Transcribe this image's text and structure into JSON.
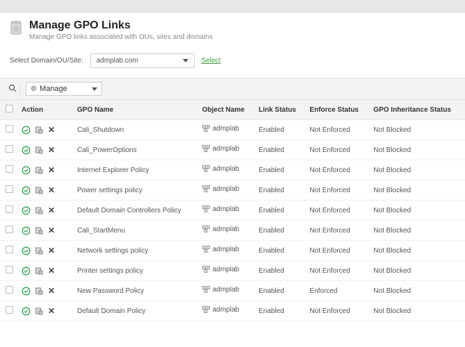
{
  "header": {
    "title": "Manage GPO Links",
    "subtitle": "Manage GPO links associated with OUs, sites and domains"
  },
  "filter": {
    "label": "Select Domain/OU/Site:",
    "domain_value": "admplab.com",
    "select_label": "Select"
  },
  "toolbar": {
    "manage_label": "Manage"
  },
  "columns": {
    "action": "Action",
    "gpo_name": "GPO Name",
    "object_name": "Object Name",
    "link_status": "Link Status",
    "enforce_status": "Enforce Status",
    "inheritance": "GPO Inheritance Status"
  },
  "rows": [
    {
      "gpo": "Cali_Shutdown",
      "obj": "admplab",
      "link": "Enabled",
      "enforce": "Not Enforced",
      "inherit": "Not Blocked"
    },
    {
      "gpo": "Cali_PowerOptions",
      "obj": "admplab",
      "link": "Enabled",
      "enforce": "Not Enforced",
      "inherit": "Not Blocked"
    },
    {
      "gpo": "Internet Explorer Policy",
      "obj": "admplab",
      "link": "Enabled",
      "enforce": "Not Enforced",
      "inherit": "Not Blocked"
    },
    {
      "gpo": "Power settings policy",
      "obj": "admplab",
      "link": "Enabled",
      "enforce": "Not Enforced",
      "inherit": "Not Blocked"
    },
    {
      "gpo": "Default Domain Controllers Policy",
      "obj": "admplab",
      "link": "Enabled",
      "enforce": "Not Enforced",
      "inherit": "Not Blocked"
    },
    {
      "gpo": "Cali_StartMenu",
      "obj": "admplab",
      "link": "Enabled",
      "enforce": "Not Enforced",
      "inherit": "Not Blocked"
    },
    {
      "gpo": "Network settings policy",
      "obj": "admplab",
      "link": "Enabled",
      "enforce": "Not Enforced",
      "inherit": "Not Blocked"
    },
    {
      "gpo": "Printer settings policy",
      "obj": "admplab",
      "link": "Enabled",
      "enforce": "Not Enforced",
      "inherit": "Not Blocked"
    },
    {
      "gpo": "New Password Policy",
      "obj": "admplab",
      "link": "Enabled",
      "enforce": "Enforced",
      "inherit": "Not Blocked"
    },
    {
      "gpo": "Default Domain Policy",
      "obj": "admplab",
      "link": "Enabled",
      "enforce": "Not Enforced",
      "inherit": "Not Blocked"
    }
  ]
}
